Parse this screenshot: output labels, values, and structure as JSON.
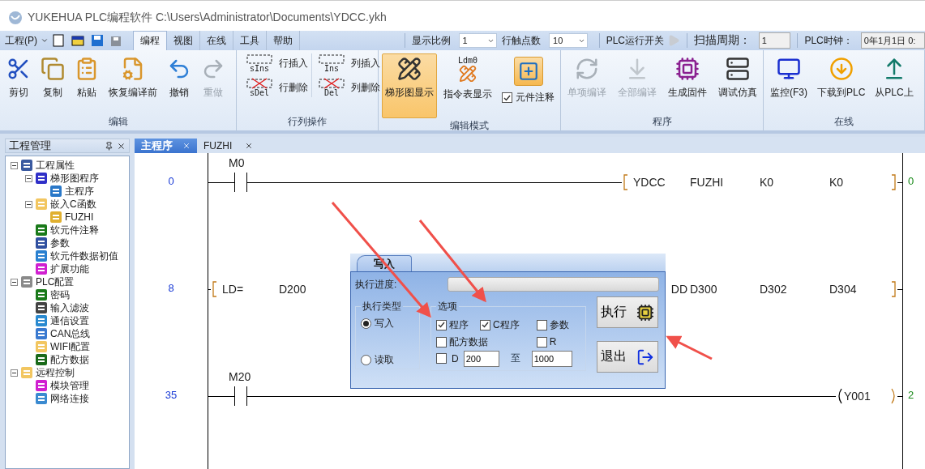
{
  "window": {
    "title": "YUKEHUA PLC编程软件 C:\\Users\\Administrator\\Documents\\YDCC.ykh"
  },
  "menu": {
    "file_menu": "工程(P)",
    "tabs": [
      {
        "label": "编程",
        "selected": true
      },
      {
        "label": "视图",
        "selected": false
      },
      {
        "label": "在线",
        "selected": false
      },
      {
        "label": "工具",
        "selected": false
      },
      {
        "label": "帮助",
        "selected": false
      }
    ]
  },
  "toolbar": {
    "zoom_label": "显示比例",
    "zoom_value": "1",
    "contacts_label": "行触点数",
    "contacts_value": "10",
    "run_switch_label": "PLC运行开关",
    "scan_label": "扫描周期：",
    "scan_value": "1",
    "clock_label": "PLC时钟：",
    "clock_value": "0年1月1日 0:"
  },
  "ribbon": {
    "groups": [
      {
        "title": "编辑",
        "items": [
          {
            "kind": "large",
            "label": "剪切",
            "disabled": false
          },
          {
            "kind": "large",
            "label": "复制",
            "disabled": false
          },
          {
            "kind": "large",
            "label": "粘贴",
            "disabled": false
          },
          {
            "kind": "large",
            "label": "恢复编译前",
            "disabled": false
          },
          {
            "kind": "large",
            "label": "撤销",
            "disabled": false
          },
          {
            "kind": "large",
            "label": "重做",
            "disabled": true
          }
        ]
      },
      {
        "title": "行列操作",
        "items": [
          {
            "kind": "small",
            "label": "行插入",
            "icon_text": "sIns"
          },
          {
            "kind": "small",
            "label": "行删除",
            "icon_text": "sDel"
          },
          {
            "kind": "small",
            "label": "列插入",
            "icon_text": "Ins"
          },
          {
            "kind": "small",
            "label": "列删除",
            "icon_text": "Del"
          }
        ]
      },
      {
        "title": "编辑模式",
        "items": [
          {
            "kind": "large",
            "label": "梯形图显示",
            "disabled": false,
            "selected": true
          },
          {
            "kind": "large",
            "label": "指令表显示",
            "disabled": false,
            "selected": false,
            "icon_text": "Ldm0"
          },
          {
            "kind": "checkbox",
            "label": "元件注释",
            "checked": true
          }
        ]
      },
      {
        "title": "程序",
        "items": [
          {
            "kind": "large",
            "label": "单项编译",
            "disabled": true
          },
          {
            "kind": "large",
            "label": "全部编译",
            "disabled": true
          },
          {
            "kind": "large",
            "label": "生成固件",
            "disabled": false
          },
          {
            "kind": "large",
            "label": "调试仿真",
            "disabled": false
          }
        ]
      },
      {
        "title": "在线",
        "items": [
          {
            "kind": "large",
            "label": "监控(F3)",
            "disabled": false
          },
          {
            "kind": "large",
            "label": "下载到PLC",
            "disabled": false
          },
          {
            "kind": "large",
            "label": "从PLC上",
            "disabled": false
          }
        ]
      }
    ]
  },
  "project_panel": {
    "title": "工程管理",
    "tree": [
      {
        "label": "工程属性",
        "expanded": true,
        "children": [
          {
            "label": "梯形图程序",
            "expanded": true,
            "children": [
              {
                "label": "主程序"
              }
            ]
          },
          {
            "label": "嵌入C函数",
            "expanded": true,
            "children": [
              {
                "label": "FUZHI"
              }
            ]
          },
          {
            "label": "软元件注释"
          },
          {
            "label": "参数"
          },
          {
            "label": "软元件数据初值"
          },
          {
            "label": "扩展功能"
          }
        ]
      },
      {
        "label": "PLC配置",
        "expanded": true,
        "children": [
          {
            "label": "密码"
          },
          {
            "label": "输入滤波"
          },
          {
            "label": "通信设置"
          },
          {
            "label": "CAN总线"
          },
          {
            "label": "WIFI配置"
          },
          {
            "label": "配方数据"
          }
        ]
      },
      {
        "label": "远程控制",
        "expanded": true,
        "children": [
          {
            "label": "模块管理"
          },
          {
            "label": "网络连接"
          }
        ]
      }
    ]
  },
  "editor": {
    "tabs": [
      {
        "label": "主程序",
        "selected": true
      },
      {
        "label": "FUZHI",
        "selected": false
      }
    ],
    "rungs": [
      {
        "kind": "function",
        "step": "0",
        "contact": "M0",
        "operands": [
          "YDCC",
          "FUZHI",
          "K0",
          "K0"
        ],
        "count": "0"
      },
      {
        "kind": "compare",
        "step": "8",
        "compare": [
          "LD=",
          "D200"
        ],
        "operands": [
          "DD",
          "D300",
          "D302",
          "D304"
        ]
      },
      {
        "kind": "coil",
        "step": "35",
        "contact": "M20",
        "coil": "Y001",
        "count": "2"
      }
    ]
  },
  "dialog": {
    "tab": "写入",
    "progress_label": "执行进度:",
    "progress": {
      "level": 0
    },
    "type_group": {
      "title": "执行类型",
      "options": [
        {
          "label": "写入",
          "selected": true
        },
        {
          "label": "读取",
          "selected": false
        }
      ]
    },
    "options_group": {
      "title": "选项",
      "rows": [
        {
          "items": [
            {
              "kind": "checkbox",
              "label": "程序",
              "checked": true
            },
            {
              "kind": "checkbox",
              "label": "C程序",
              "checked": true
            },
            {
              "kind": "checkbox",
              "label": "参数",
              "checked": false
            }
          ]
        },
        {
          "items": [
            {
              "kind": "checkbox",
              "label": "配方数据",
              "checked": false
            },
            {
              "kind": "checkbox",
              "label": "R",
              "checked": false
            }
          ]
        },
        {
          "items": [
            {
              "kind": "range",
              "label": "D",
              "checked": false,
              "from": "200",
              "to_label": "至",
              "to": "1000"
            }
          ]
        }
      ]
    },
    "buttons": [
      {
        "kind": "run",
        "label": "执行"
      },
      {
        "kind": "exit",
        "label": "退出"
      }
    ]
  }
}
